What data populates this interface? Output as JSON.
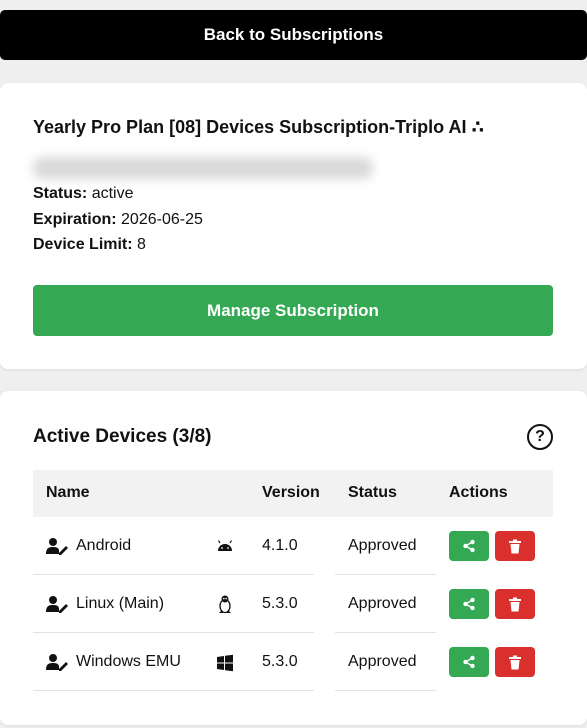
{
  "back_button": {
    "label": "Back to Subscriptions"
  },
  "subscription": {
    "title": "Yearly Pro Plan [08] Devices Subscription-Triplo AI",
    "title_suffix": "∴",
    "status_label": "Status:",
    "status_value": "active",
    "expiration_label": "Expiration:",
    "expiration_value": "2026-06-25",
    "device_limit_label": "Device Limit:",
    "device_limit_value": "8",
    "manage_button": "Manage Subscription"
  },
  "devices": {
    "title": "Active Devices (3/8)",
    "help_icon": "?",
    "columns": [
      "Name",
      "Version",
      "Status",
      "Actions"
    ],
    "rows": [
      {
        "name": "Android",
        "os_icon": "android-icon",
        "version": "4.1.0",
        "status": "Approved"
      },
      {
        "name": "Linux (Main)",
        "os_icon": "linux-icon",
        "version": "5.3.0",
        "status": "Approved"
      },
      {
        "name": "Windows EMU",
        "os_icon": "windows-icon",
        "version": "5.3.0",
        "status": "Approved"
      }
    ]
  },
  "colors": {
    "green": "#34a853",
    "red": "#d9302e",
    "black": "#000000"
  }
}
